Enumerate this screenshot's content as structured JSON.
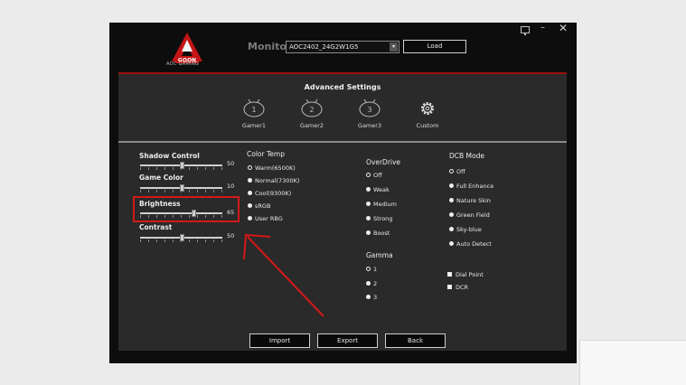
{
  "window": {
    "logo_caption": "AOC GAMING",
    "logo_text": "GOON",
    "monitor_label": "Monitor",
    "monitor_value": "AOC2402_24G2W1G5",
    "load_label": "Load",
    "controls": {
      "minimize": "–",
      "close": "✕"
    }
  },
  "panel": {
    "title": "Advanced Settings",
    "modes": [
      {
        "label": "Gamer1",
        "digit": "1"
      },
      {
        "label": "Gamer2",
        "digit": "2"
      },
      {
        "label": "Gamer3",
        "digit": "3"
      },
      {
        "label": "Custom",
        "icon": "gear-icon"
      }
    ]
  },
  "sliders": [
    {
      "label": "Shadow Control",
      "value": "50",
      "level": 0.5
    },
    {
      "label": "Game Color",
      "value": "10",
      "level": 0.5
    },
    {
      "label": "Brightness",
      "value": "65",
      "level": 0.65
    },
    {
      "label": "Contrast",
      "value": "50",
      "level": 0.5
    }
  ],
  "color_temp": {
    "title": "Color Temp",
    "options": [
      "Warm(6500K)",
      "Normal(7300K)",
      "Cool(9300K)",
      "sRGB",
      "User RBG"
    ],
    "selected": "Warm(6500K)"
  },
  "overdrive": {
    "title": "OverDrive",
    "options": [
      "Off",
      "Weak",
      "Medium",
      "Strong",
      "Boost"
    ],
    "selected": "Off"
  },
  "gamma": {
    "title": "Gamma",
    "options": [
      "1",
      "2",
      "3"
    ],
    "selected": "1"
  },
  "dcb_mode": {
    "title": "DCB Mode",
    "options": [
      "Off",
      "Full Enhance",
      "Nature Skin",
      "Green Field",
      "Sky-blue",
      "Auto Detect"
    ],
    "selected": "Off"
  },
  "checkboxes": [
    "Dial Point",
    "DCR"
  ],
  "buttons": {
    "import": "Import",
    "export": "Export",
    "back": "Back"
  },
  "colors": {
    "accent_red": "#a01010",
    "annotation_red": "#d31818",
    "background": "#0d0d0d",
    "panel": "#2a2a2a"
  }
}
